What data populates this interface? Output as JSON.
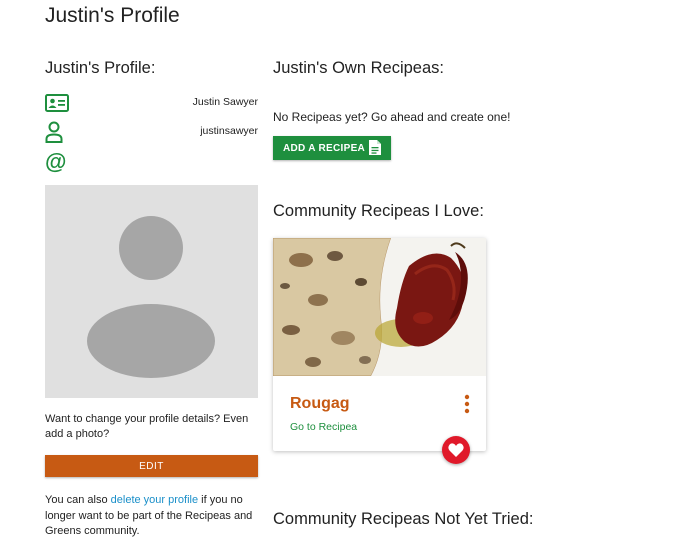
{
  "page": {
    "title": "Justin's Profile"
  },
  "profile": {
    "heading": "Justin's Profile:",
    "name": "Justin Sawyer",
    "username": "justinsawyer",
    "email": "",
    "change_text": "Want to change your profile details? Even add a photo?",
    "edit_label": "EDIT",
    "delete_prefix": "You can also ",
    "delete_link": "delete your profile",
    "delete_suffix": " if you no longer want to be part of the Recipeas and Greens community.",
    "icons": [
      "id-card-icon",
      "user-icon",
      "at-icon"
    ]
  },
  "own_recipeas": {
    "heading": "Justin's Own Recipeas:",
    "empty_text": "No Recipeas yet? Go ahead and create one!",
    "add_label": "ADD A RECIPEA"
  },
  "community_love": {
    "heading": "Community Recipeas I Love:",
    "cards": [
      {
        "title": "Rougag",
        "link_label": "Go to Recipea",
        "liked": true
      }
    ]
  },
  "community_not_tried": {
    "heading": "Community Recipeas Not Yet Tried:"
  },
  "colors": {
    "green": "#1e8f3e",
    "orange": "#c75a13",
    "link_blue": "#1a8fc9",
    "heart_red": "#e0192a"
  }
}
